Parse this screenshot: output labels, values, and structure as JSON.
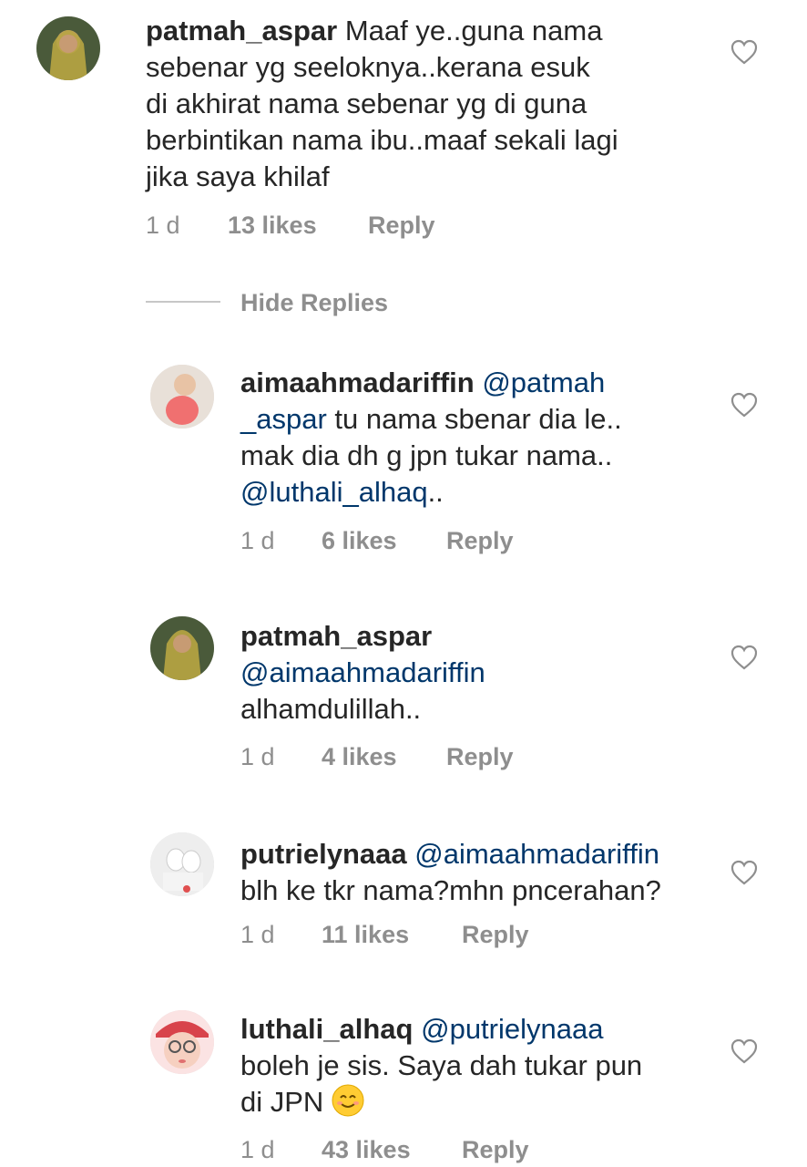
{
  "comments": [
    {
      "username": "patmah_aspar",
      "lines": [
        "Maaf ye..guna nama",
        "sebenar yg seeloknya..kerana esuk",
        "di akhirat nama sebenar yg di guna",
        "berbintikan nama ibu..maaf sekali lagi",
        "jika saya khilaf"
      ],
      "time": "1 d",
      "likes": "13 likes",
      "reply": "Reply"
    },
    {
      "username": "aimaahmadariffin",
      "mention1": "@patmah",
      "mention1b": "_aspar",
      "text1": " tu nama sbenar dia le..",
      "text2": "mak dia dh g jpn tukar nama..",
      "mention2": "@luthali_alhaq",
      "text3": "..",
      "time": "1 d",
      "likes": "6 likes",
      "reply": "Reply"
    },
    {
      "username": "patmah_aspar",
      "mention": "@aimaahmadariffin",
      "text": "alhamdulillah..",
      "time": "1 d",
      "likes": "4 likes",
      "reply": "Reply"
    },
    {
      "username": "putrielynaaa",
      "mention": "@aimaahmadariffin",
      "text": "blh ke tkr nama?mhn pncerahan?",
      "time": "1 d",
      "likes": "11 likes",
      "reply": "Reply"
    },
    {
      "username": "luthali_alhaq",
      "mention": "@putrielynaaa",
      "text1": "boleh je sis. Saya dah tukar pun",
      "text2": "di JPN",
      "emoji": "smiling-face-emoji",
      "time": "1 d",
      "likes": "43 likes",
      "reply": "Reply"
    }
  ],
  "hide_replies": "Hide Replies",
  "icons": {
    "like": "heart-outline-icon"
  },
  "colors": {
    "text": "#262626",
    "mention": "#00376b",
    "meta": "#8e8e8e"
  }
}
